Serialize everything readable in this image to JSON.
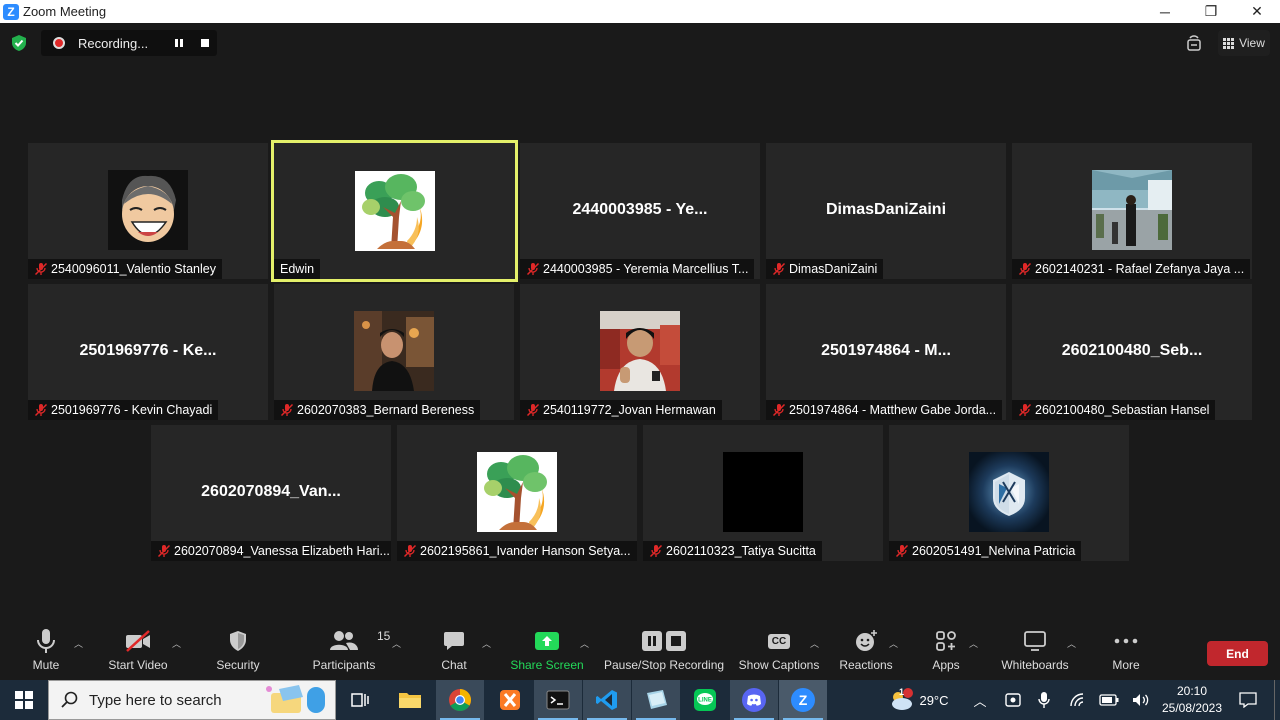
{
  "window": {
    "title": "Zoom Meeting",
    "logo": "Z",
    "minimize": "─",
    "maximize": "❐",
    "close": "✕"
  },
  "status": {
    "recording_label": "Recording...",
    "view_label": "View"
  },
  "participants": [
    {
      "label": "2540096011_Valentio Stanley",
      "big": "",
      "avatar": "cartoon"
    },
    {
      "label": "Edwin",
      "big": "",
      "avatar": "tree",
      "active": true
    },
    {
      "label": "2440003985 - Yeremia Marcellius T...",
      "big": "2440003985 - Ye...",
      "avatar": ""
    },
    {
      "label": "DimasDaniZaini",
      "big": "DimasDaniZaini",
      "avatar": ""
    },
    {
      "label": "2602140231 - Rafael Zefanya Jaya ...",
      "big": "",
      "avatar": "photo-building"
    },
    {
      "label": "2501969776 - Kevin Chayadi",
      "big": "2501969776 - Ke...",
      "avatar": ""
    },
    {
      "label": "2602070383_Bernard Bereness",
      "big": "",
      "avatar": "photo-person-dark"
    },
    {
      "label": "2540119772_Jovan Hermawan",
      "big": "",
      "avatar": "photo-person-red"
    },
    {
      "label": "2501974864 - Matthew Gabe Jorda...",
      "big": "2501974864 - M...",
      "avatar": ""
    },
    {
      "label": "2602100480_Sebastian Hansel",
      "big": "2602100480_Seb...",
      "avatar": ""
    },
    {
      "label": "2602070894_Vanessa Elizabeth Hari...",
      "big": "2602070894_Van...",
      "avatar": ""
    },
    {
      "label": "2602195861_Ivander Hanson Setya...",
      "big": "",
      "avatar": "tree"
    },
    {
      "label": "2602110323_Tatiya Sucitta",
      "big": "",
      "avatar": "black"
    },
    {
      "label": "2602051491_Nelvina Patricia",
      "big": "",
      "avatar": "emblem"
    }
  ],
  "toolbar": {
    "mute": "Mute",
    "start_video": "Start Video",
    "security": "Security",
    "participants": "Participants",
    "participants_count": "15",
    "chat": "Chat",
    "share_screen": "Share Screen",
    "pause_stop_recording": "Pause/Stop Recording",
    "show_captions": "Show Captions",
    "cc": "CC",
    "reactions": "Reactions",
    "apps": "Apps",
    "whiteboards": "Whiteboards",
    "more": "More",
    "end": "End"
  },
  "taskbar": {
    "search_placeholder": "Type here to search",
    "weather_temp": "29°C",
    "weather_badge": "1",
    "time": "20:10",
    "date": "25/08/2023"
  },
  "colors": {
    "active_border": "#e4f06a",
    "share_green": "#23d959",
    "end_red": "#c1272d",
    "muted_red": "#e02828"
  }
}
